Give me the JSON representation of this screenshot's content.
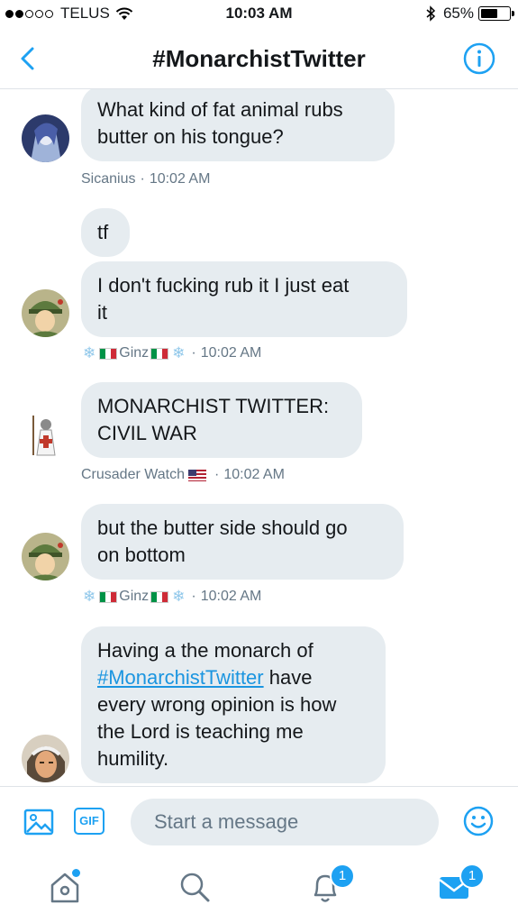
{
  "status_bar": {
    "carrier": "TELUS",
    "time": "10:03 AM",
    "battery": "65%",
    "battery_level": 0.65
  },
  "nav": {
    "title": "#MonarchistTwitter",
    "back_icon": "chevron-left-icon",
    "info_icon": "info-icon"
  },
  "messages": [
    {
      "lines": [
        "What kind of fat animal rubs",
        "butter on his tongue?"
      ]
    },
    {
      "lines": [
        "tf"
      ]
    },
    {
      "lines": [
        "I don't fucking rub it I just eat",
        "it"
      ]
    },
    {
      "lines": [
        "MONARCHIST TWITTER:",
        "CIVIL WAR"
      ]
    },
    {
      "lines": [
        "but the butter side should go",
        "on bottom"
      ]
    },
    {
      "lines": [
        "Having a the monarch of",
        "#MonarchistTwitter",
        " have",
        "every wrong opinion is how",
        "the Lord is teaching me",
        "humility."
      ]
    }
  ],
  "meta": [
    {
      "name": "Sicanius",
      "time": "10:02 AM"
    },
    {
      "name": "Ginz",
      "time": "10:02 AM"
    },
    {
      "name": "Crusader Watch",
      "time": "10:02 AM"
    },
    {
      "name": "Ginz",
      "time": "10:02 AM"
    }
  ],
  "dot_separator": "·",
  "composer": {
    "placeholder": "Start a message",
    "gif_label": "GIF"
  },
  "tabbar": {
    "notifications_badge": "1",
    "messages_badge": "1"
  },
  "colors": {
    "accent": "#1da1f2",
    "bubble": "#e6ecf0",
    "meta_text": "#657786"
  }
}
